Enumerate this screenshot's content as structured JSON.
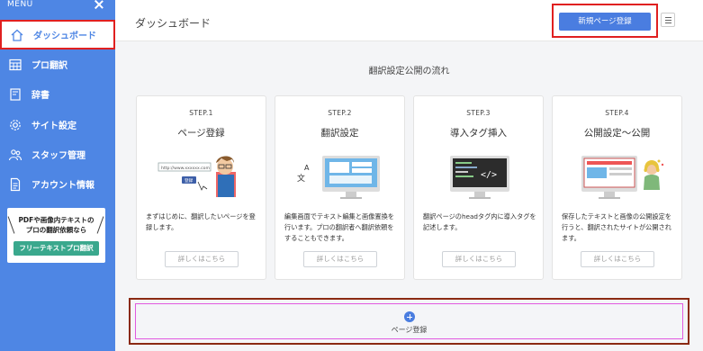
{
  "sidebar": {
    "menu_title": "MENU",
    "items": [
      {
        "label": "ダッシュボード",
        "icon": "home-icon",
        "active": true
      },
      {
        "label": "プロ翻訳",
        "icon": "calendar-grid-icon",
        "active": false
      },
      {
        "label": "辞書",
        "icon": "book-icon",
        "active": false
      },
      {
        "label": "サイト設定",
        "icon": "gear-icon",
        "active": false
      },
      {
        "label": "スタッフ管理",
        "icon": "people-icon",
        "active": false
      },
      {
        "label": "アカウント情報",
        "icon": "document-icon",
        "active": false
      }
    ],
    "promo": {
      "line1": "PDFや画像内テキストの",
      "line2": "プロの翻訳依頼なら",
      "button": "フリーテキストプロ翻訳"
    }
  },
  "header": {
    "title": "ダッシュボード",
    "new_page_button": "新規ページ登録",
    "menu_icon": "hamburger-icon"
  },
  "flow": {
    "title": "翻訳設定公開の流れ",
    "steps": [
      {
        "step": "STEP.1",
        "title": "ページ登録",
        "desc": "まずはじめに、翻訳したいページを登録します。",
        "button": "詳しくはこちら",
        "url_sample": "http://www.xxxxxx.com",
        "reg_label": "登録"
      },
      {
        "step": "STEP.2",
        "title": "翻訳設定",
        "desc": "編集画面でテキスト編集と画像置換を行います。プロの翻訳者へ翻訳依頼をすることもできます。",
        "button": "詳しくはこちら"
      },
      {
        "step": "STEP.3",
        "title": "導入タグ挿入",
        "desc": "翻訳ページのheadタグ内に導入タグを記述します。",
        "button": "詳しくはこちら"
      },
      {
        "step": "STEP.4",
        "title": "公開設定〜公開",
        "desc": "保存したテキストと画像の公開設定を行うと、翻訳されたサイトが公開されます。",
        "button": "詳しくはこちら"
      }
    ]
  },
  "add_page": {
    "label": "ページ登録"
  },
  "colors": {
    "sidebar": "#4e86e4",
    "primary_button": "#4a7de0",
    "promo_button": "#3aa88d",
    "highlight_red": "#e02020"
  }
}
